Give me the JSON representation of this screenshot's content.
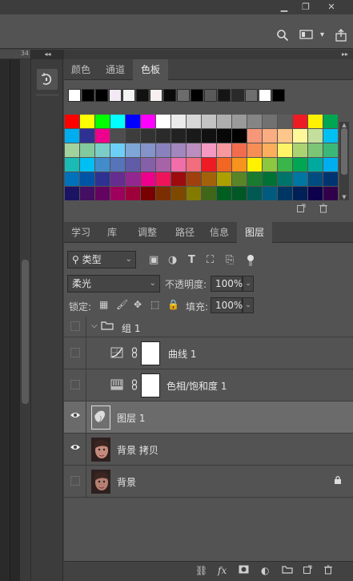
{
  "window": {
    "minimize": "▁",
    "restore": "❐",
    "close": "✕"
  },
  "optionsbar": {
    "search_icon": "search-icon",
    "workspace_icon": "workspace-icon",
    "workspace_arrow": "▾",
    "share_icon": "share-icon"
  },
  "doc": {
    "ruler_label": "34"
  },
  "tools": {
    "active_icon": "rotate-view-icon"
  },
  "swatch_panel": {
    "tabs": [
      "颜色",
      "通道",
      "色板"
    ],
    "active_tab": 2,
    "recent": [
      "#ffffff",
      "#000000",
      "#000000",
      "#f2e9f4",
      "#f4f4f4",
      "#111111",
      "#f8f0f0",
      "#0a0a0a",
      "#6c6c6c",
      "#000000",
      "#5a5a5a",
      "#151515",
      "#2a2a2a",
      "#6e6e6e",
      "#ffffff",
      "#000000"
    ],
    "grid": [
      [
        "#ff0000",
        "#ffff00",
        "#00ff00",
        "#00ffff",
        "#0000ff",
        "#ff00ff",
        "#ffffff",
        "#ebebeb",
        "#d7d7d7",
        "#c3c3c3",
        "#aeaeae",
        "#9a9a9a",
        "#858585",
        "#717171",
        "#5c5c5c",
        "#ed1c24",
        "#fff200",
        "#00a651"
      ],
      [
        "#00aeef",
        "#2e3192",
        "#ec008c",
        "#4d4d4d",
        "#3d3d3d",
        "#333333",
        "#2b2b2b",
        "#222222",
        "#1a1a1a",
        "#111111",
        "#080808",
        "#000000",
        "#f7977a",
        "#f9ad81",
        "#fdc68a",
        "#fff79a",
        "#c4df9b",
        "#00bff3"
      ],
      [
        "#a3d39c",
        "#82ca9d",
        "#7bcdc8",
        "#6ecff6",
        "#7ea7d8",
        "#8493ca",
        "#8882be",
        "#a187be",
        "#bc8dbf",
        "#f49ac2",
        "#f6989d",
        "#f26c4f",
        "#f68e55",
        "#fbaf5c",
        "#fff467",
        "#acd372",
        "#7cc576",
        "#3bb878"
      ],
      [
        "#1abbb4",
        "#00bff3",
        "#438ccb",
        "#5574b9",
        "#605ca8",
        "#855fa8",
        "#a763a8",
        "#f06ea9",
        "#f26d7d",
        "#ed1c24",
        "#f26522",
        "#f7941d",
        "#fff200",
        "#8dc63f",
        "#39b54a",
        "#00a651",
        "#00a99d",
        "#00aeef"
      ],
      [
        "#0072bc",
        "#0054a6",
        "#2e3192",
        "#662d91",
        "#92278f",
        "#ec008c",
        "#ed145b",
        "#9e0b0f",
        "#a0410d",
        "#a3620a",
        "#aba000",
        "#598527",
        "#197b30",
        "#007236",
        "#00746b",
        "#0076a3",
        "#004b80",
        "#003471"
      ],
      [
        "#1b1464",
        "#440e62",
        "#630460",
        "#9e005d",
        "#9e0039",
        "#790000",
        "#7b2e00",
        "#7d4900",
        "#827b00",
        "#406618",
        "#005e20",
        "#005826",
        "#005952",
        "#005b7f",
        "#003663",
        "#002157",
        "#0d004c",
        "#32004b"
      ]
    ]
  },
  "layers_panel": {
    "tabs": [
      "学习",
      "库",
      "调整",
      "路径",
      "信息",
      "图层"
    ],
    "active_tab": 5,
    "filter_label": "类型",
    "blend_mode": "柔光",
    "opacity_label": "不透明度:",
    "opacity_value": "100%",
    "lock_label": "锁定:",
    "fill_label": "填充:",
    "fill_value": "100%",
    "layers": [
      {
        "name": "组 1",
        "kind": "group",
        "visible": false
      },
      {
        "name": "曲线 1",
        "kind": "curves",
        "visible": false
      },
      {
        "name": "色相/饱和度 1",
        "kind": "huesat",
        "visible": false
      },
      {
        "name": "图层 1",
        "kind": "pixel",
        "visible": true,
        "selected": true
      },
      {
        "name": "背景 拷贝",
        "kind": "photo",
        "visible": true
      },
      {
        "name": "背景",
        "kind": "photo",
        "visible": false,
        "locked": true
      }
    ]
  },
  "colors": {
    "panel_bg": "#535353",
    "selected_row": "#6b6b6b",
    "dark_bg": "#282828"
  }
}
